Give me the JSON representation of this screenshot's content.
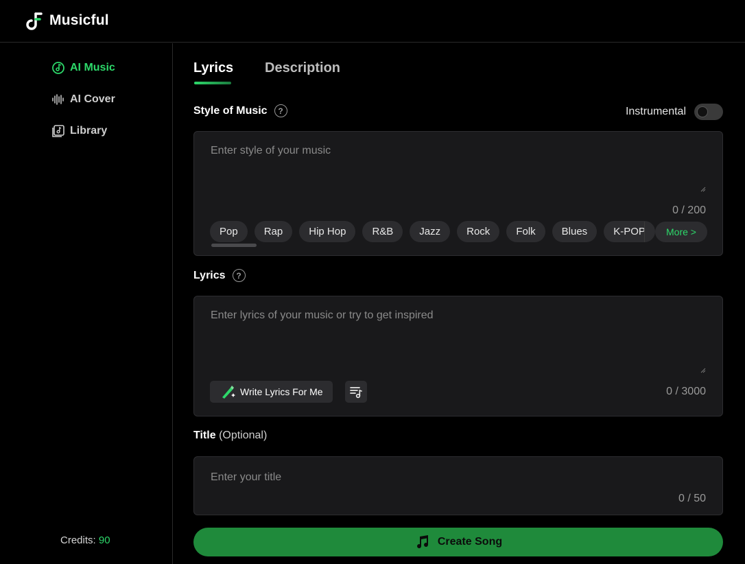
{
  "app": {
    "name": "Musicful"
  },
  "sidebar": {
    "items": [
      {
        "label": "AI Music",
        "icon": "music-disc-icon",
        "active": true
      },
      {
        "label": "AI Cover",
        "icon": "waveform-icon",
        "active": false
      },
      {
        "label": "Library",
        "icon": "library-icon",
        "active": false
      }
    ],
    "credits_label": "Credits:",
    "credits_value": "90"
  },
  "tabs": [
    {
      "label": "Lyrics",
      "active": true
    },
    {
      "label": "Description",
      "active": false
    }
  ],
  "style_section": {
    "label": "Style of Music",
    "help": "?",
    "instrumental_label": "Instrumental",
    "instrumental_on": false,
    "placeholder": "Enter style of your music",
    "counter": "0 / 200",
    "genres": [
      "Pop",
      "Rap",
      "Hip Hop",
      "R&B",
      "Jazz",
      "Rock",
      "Folk",
      "Blues",
      "K-POP"
    ],
    "more_label": "More >"
  },
  "lyrics_section": {
    "label": "Lyrics",
    "help": "?",
    "placeholder": "Enter lyrics of your music or try to get inspired",
    "write_button": "Write Lyrics For Me",
    "counter": "0 / 3000"
  },
  "title_section": {
    "label": "Title",
    "optional": "(Optional)",
    "placeholder": "Enter your title",
    "counter": "0 / 50"
  },
  "create_button": "Create Song",
  "colors": {
    "accent": "#2dd86a",
    "button_green": "#1f8a3b",
    "panel": "#19191b",
    "background": "#000000"
  }
}
